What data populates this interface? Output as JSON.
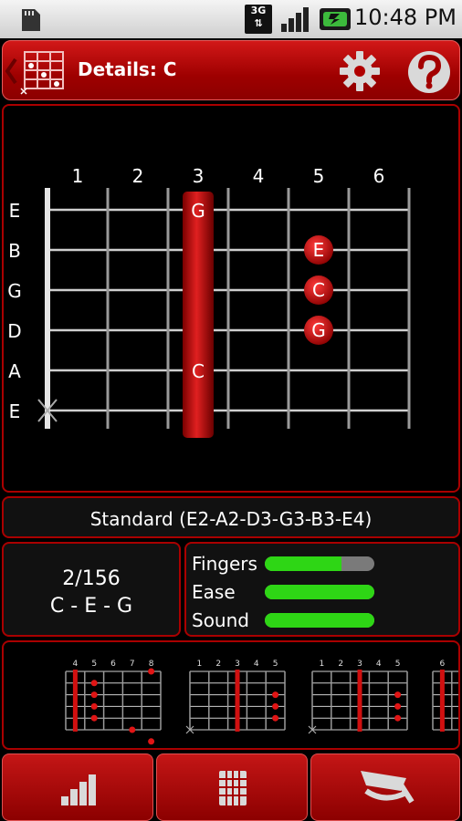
{
  "status_bar": {
    "network_label": "3G",
    "time": "10:48 PM",
    "icons": [
      "sd-card-icon",
      "network-3g-icon",
      "signal-icon",
      "battery-charging-icon"
    ]
  },
  "header": {
    "title": "Details: C",
    "icons": [
      "back-chevron-icon",
      "chord-grid-icon",
      "gear-icon",
      "help-icon"
    ]
  },
  "chord": {
    "fret_numbers": [
      "1",
      "2",
      "3",
      "4",
      "5",
      "6"
    ],
    "string_names": [
      "E",
      "B",
      "G",
      "D",
      "A",
      "E"
    ],
    "barre": {
      "fret": 3,
      "from_string": 1,
      "to_string": 5,
      "top_note": "G",
      "bottom_note": "C"
    },
    "dots": [
      {
        "string": 2,
        "fret": 5,
        "note": "E"
      },
      {
        "string": 3,
        "fret": 5,
        "note": "C"
      },
      {
        "string": 4,
        "fret": 5,
        "note": "G"
      }
    ],
    "muted_strings": [
      6
    ]
  },
  "tuning": {
    "label": "Standard (E2-A2-D3-G3-B3-E4)"
  },
  "counter": {
    "position": "2/156",
    "notes": "C - E - G"
  },
  "ratings": [
    {
      "label": "Fingers",
      "value": 0.7
    },
    {
      "label": "Ease",
      "value": 1.0
    },
    {
      "label": "Sound",
      "value": 1.0
    }
  ],
  "variants": [
    {
      "frets": [
        "4",
        "5",
        "6",
        "7",
        "8"
      ],
      "barre_string_col": 0,
      "dots": [
        [
          1,
          1
        ],
        [
          2,
          1
        ],
        [
          3,
          1
        ],
        [
          4,
          1
        ],
        [
          0,
          4
        ],
        [
          5,
          3
        ],
        [
          6,
          4
        ]
      ],
      "muted": false
    },
    {
      "frets": [
        "1",
        "2",
        "3",
        "4",
        "5"
      ],
      "barre_string_col": 2,
      "dots": [
        [
          2,
          4
        ],
        [
          3,
          4
        ],
        [
          4,
          4
        ]
      ],
      "muted": true
    },
    {
      "frets": [
        "1",
        "2",
        "3",
        "4",
        "5"
      ],
      "barre_string_col": 2,
      "dots": [
        [
          2,
          4
        ],
        [
          3,
          4
        ],
        [
          4,
          4
        ]
      ],
      "muted": true
    },
    {
      "frets": [
        "6"
      ],
      "barre_string_col": 0,
      "dots": [],
      "muted": false
    }
  ],
  "bottom_nav": [
    "signal-bars-icon",
    "chord-grid-icon",
    "capo-icon"
  ],
  "colors": {
    "accent": "#b00000",
    "rating_fill": "#2ed615",
    "rating_empty": "#7a7a7a"
  }
}
